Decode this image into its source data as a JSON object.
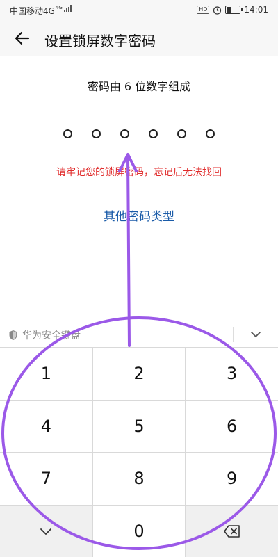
{
  "status_bar": {
    "carrier": "中国移动4G",
    "network_badge": "4G",
    "hd_badge": "HD",
    "time": "14:01",
    "battery_level": 0.35
  },
  "header": {
    "title": "设置锁屏数字密码",
    "back_icon": "arrow-left-icon"
  },
  "content": {
    "hint": "密码由 6 位数字组成",
    "dot_count": 6,
    "warning": "请牢记您的锁屏密码，忘记后无法找回",
    "other_types_link": "其他密码类型"
  },
  "keyboard": {
    "brand_label": "华为安全键盘",
    "brand_icon": "shield-icon",
    "collapse_icon": "chevron-down-icon",
    "keys": [
      "1",
      "2",
      "3",
      "4",
      "5",
      "6",
      "7",
      "8",
      "9",
      "",
      "0",
      ""
    ],
    "hide_key_icon": "chevron-down-icon",
    "delete_key_icon": "backspace-icon"
  },
  "colors": {
    "warning": "#e02b2b",
    "link": "#1a5ba8",
    "annotation": "#9b59e8",
    "bar_bg": "#f7f7f7"
  }
}
